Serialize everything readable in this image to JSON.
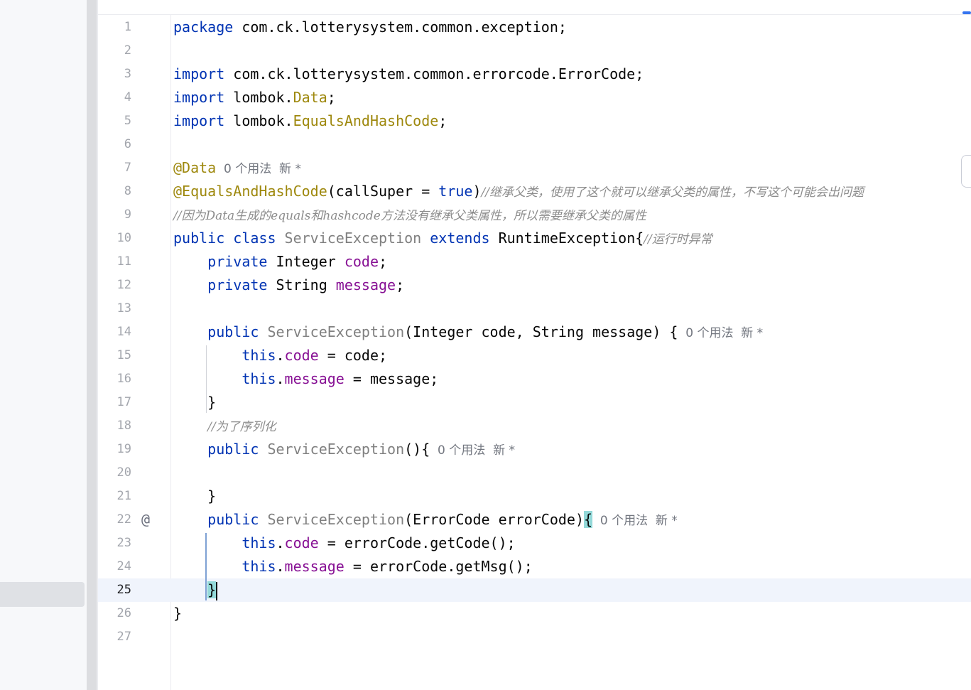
{
  "editor": {
    "current_line": 25,
    "hint_usages": "0 个用法",
    "hint_new": "新 *",
    "lines": [
      {
        "n": "1",
        "tokens": [
          {
            "t": "package",
            "c": "kw"
          },
          {
            "t": " com.ck.lotterysystem.common.exception;"
          }
        ]
      },
      {
        "n": "2",
        "tokens": []
      },
      {
        "n": "3",
        "tokens": [
          {
            "t": "import",
            "c": "kw"
          },
          {
            "t": " com.ck.lotterysystem.common.errorcode.ErrorCode;"
          }
        ]
      },
      {
        "n": "4",
        "tokens": [
          {
            "t": "import",
            "c": "kw"
          },
          {
            "t": " lombok."
          },
          {
            "t": "Data",
            "c": "ann"
          },
          {
            "t": ";"
          }
        ]
      },
      {
        "n": "5",
        "tokens": [
          {
            "t": "import",
            "c": "kw"
          },
          {
            "t": " lombok."
          },
          {
            "t": "EqualsAndHashCode",
            "c": "ann"
          },
          {
            "t": ";"
          }
        ]
      },
      {
        "n": "6",
        "tokens": []
      },
      {
        "n": "7",
        "tokens": [
          {
            "t": "@Data",
            "c": "ann"
          },
          {
            "t": "  0 个用法  新 *",
            "c": "hint"
          }
        ]
      },
      {
        "n": "8",
        "tokens": [
          {
            "t": "@EqualsAndHashCode",
            "c": "ann"
          },
          {
            "t": "(callSuper = "
          },
          {
            "t": "true",
            "c": "kw"
          },
          {
            "t": ")"
          },
          {
            "t": "//继承父类，使用了这个就可以继承父类的属性，不写这个可能会出问题",
            "c": "cmt"
          }
        ]
      },
      {
        "n": "9",
        "tokens": [
          {
            "t": "//因为Data生成的equals和hashcode方法没有继承父类属性，所以需要继承父类的属性",
            "c": "cmt"
          }
        ]
      },
      {
        "n": "10",
        "tokens": [
          {
            "t": "public class",
            "c": "kw"
          },
          {
            "t": " "
          },
          {
            "t": "ServiceException",
            "c": "gry"
          },
          {
            "t": " "
          },
          {
            "t": "extends",
            "c": "kw"
          },
          {
            "t": " RuntimeException{"
          },
          {
            "t": "//运行时异常",
            "c": "cmt"
          }
        ]
      },
      {
        "n": "11",
        "tokens": [
          {
            "t": "    "
          },
          {
            "t": "private",
            "c": "kw"
          },
          {
            "t": " Integer "
          },
          {
            "t": "code",
            "c": "fld"
          },
          {
            "t": ";"
          }
        ]
      },
      {
        "n": "12",
        "tokens": [
          {
            "t": "    "
          },
          {
            "t": "private",
            "c": "kw"
          },
          {
            "t": " String "
          },
          {
            "t": "message",
            "c": "fld"
          },
          {
            "t": ";"
          }
        ]
      },
      {
        "n": "13",
        "tokens": []
      },
      {
        "n": "14",
        "tokens": [
          {
            "t": "    "
          },
          {
            "t": "public",
            "c": "kw"
          },
          {
            "t": " "
          },
          {
            "t": "ServiceException",
            "c": "gry"
          },
          {
            "t": "(Integer code, String message) {"
          },
          {
            "t": "  0 个用法  新 *",
            "c": "hint"
          }
        ]
      },
      {
        "n": "15",
        "tokens": [
          {
            "t": "        "
          },
          {
            "t": "this",
            "c": "kw"
          },
          {
            "t": "."
          },
          {
            "t": "code",
            "c": "fld"
          },
          {
            "t": " = code;"
          }
        ]
      },
      {
        "n": "16",
        "tokens": [
          {
            "t": "        "
          },
          {
            "t": "this",
            "c": "kw"
          },
          {
            "t": "."
          },
          {
            "t": "message",
            "c": "fld"
          },
          {
            "t": " = message;"
          }
        ]
      },
      {
        "n": "17",
        "tokens": [
          {
            "t": "    }"
          }
        ]
      },
      {
        "n": "18",
        "tokens": [
          {
            "t": "    "
          },
          {
            "t": "//为了序列化",
            "c": "cmt"
          }
        ]
      },
      {
        "n": "19",
        "tokens": [
          {
            "t": "    "
          },
          {
            "t": "public",
            "c": "kw"
          },
          {
            "t": " "
          },
          {
            "t": "ServiceException",
            "c": "gry"
          },
          {
            "t": "(){"
          },
          {
            "t": "  0 个用法  新 *",
            "c": "hint"
          }
        ]
      },
      {
        "n": "20",
        "tokens": []
      },
      {
        "n": "21",
        "tokens": [
          {
            "t": "    }"
          }
        ]
      },
      {
        "n": "22",
        "icon": "@",
        "tokens": [
          {
            "t": "    "
          },
          {
            "t": "public",
            "c": "kw"
          },
          {
            "t": " "
          },
          {
            "t": "ServiceException",
            "c": "gry"
          },
          {
            "t": "(ErrorCode errorCode)"
          },
          {
            "t": "{",
            "c": "brace-hl"
          },
          {
            "t": "  0 个用法  新 *",
            "c": "hint"
          }
        ]
      },
      {
        "n": "23",
        "tokens": [
          {
            "t": "        "
          },
          {
            "t": "this",
            "c": "kw"
          },
          {
            "t": "."
          },
          {
            "t": "code",
            "c": "fld"
          },
          {
            "t": " = errorCode.getCode();"
          }
        ]
      },
      {
        "n": "24",
        "tokens": [
          {
            "t": "        "
          },
          {
            "t": "this",
            "c": "kw"
          },
          {
            "t": "."
          },
          {
            "t": "message",
            "c": "fld"
          },
          {
            "t": " = errorCode.getMsg();"
          }
        ]
      },
      {
        "n": "25",
        "tokens": [
          {
            "t": "    "
          },
          {
            "t": "}",
            "c": "brace-hl"
          },
          {
            "t": "",
            "caret": true
          }
        ]
      },
      {
        "n": "26",
        "tokens": [
          {
            "t": "}"
          }
        ]
      },
      {
        "n": "27",
        "tokens": []
      }
    ]
  }
}
